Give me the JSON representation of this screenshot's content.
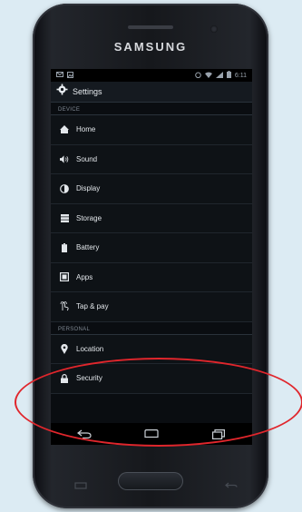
{
  "device": {
    "brand": "SAMSUNG"
  },
  "statusbar": {
    "time": "6:11"
  },
  "actionbar": {
    "title": "Settings"
  },
  "sections": {
    "device": "DEVICE",
    "personal": "PERSONAL"
  },
  "items": [
    {
      "label": "Home",
      "icon": "home-icon"
    },
    {
      "label": "Sound",
      "icon": "sound-icon"
    },
    {
      "label": "Display",
      "icon": "display-icon"
    },
    {
      "label": "Storage",
      "icon": "storage-icon"
    },
    {
      "label": "Battery",
      "icon": "battery-icon"
    },
    {
      "label": "Apps",
      "icon": "apps-icon"
    },
    {
      "label": "Tap & pay",
      "icon": "tap-pay-icon"
    },
    {
      "label": "Location",
      "icon": "location-icon"
    },
    {
      "label": "Security",
      "icon": "lock-icon"
    }
  ],
  "colors": {
    "annotation": "#e0262c",
    "background": "#dcebf3"
  }
}
